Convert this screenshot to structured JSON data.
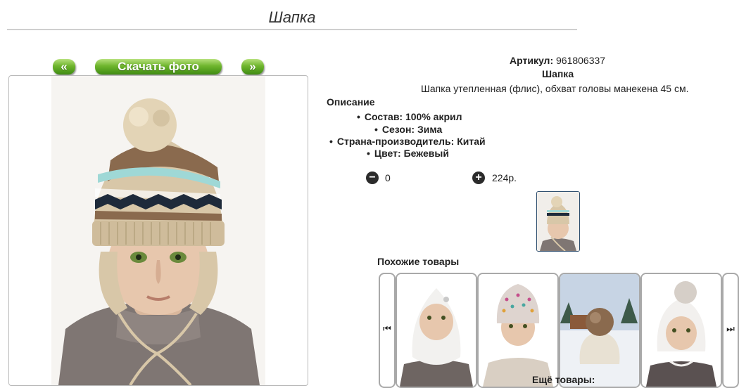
{
  "page": {
    "title": "Шапка"
  },
  "photo_nav": {
    "prev_label": "«",
    "download_label": "Скачать фото",
    "next_label": "»"
  },
  "product": {
    "article_label": "Артикул:",
    "article_value": "961806337",
    "name": "Шапка",
    "description_text": "Шапка утепленная (флис), обхват головы манекена 45 см.",
    "description_heading": "Описание",
    "attributes": [
      "Состав: 100% акрил",
      "Сезон: Зима",
      "Страна-производитель: Китай",
      "Цвет: Бежевый"
    ]
  },
  "cart": {
    "quantity": "0",
    "price": "224р."
  },
  "similar": {
    "heading": "Похожие товары",
    "more_label": "Ещё товары:",
    "prev_icon": "skip-previous-icon",
    "next_icon": "skip-next-icon"
  },
  "colors": {
    "button_green": "#6eb52d",
    "hat_beige": "#d8c7a8",
    "pattern_brown": "#8a6a4e",
    "pattern_navy": "#1e2a3a",
    "pattern_aqua": "#9fd8d6"
  }
}
